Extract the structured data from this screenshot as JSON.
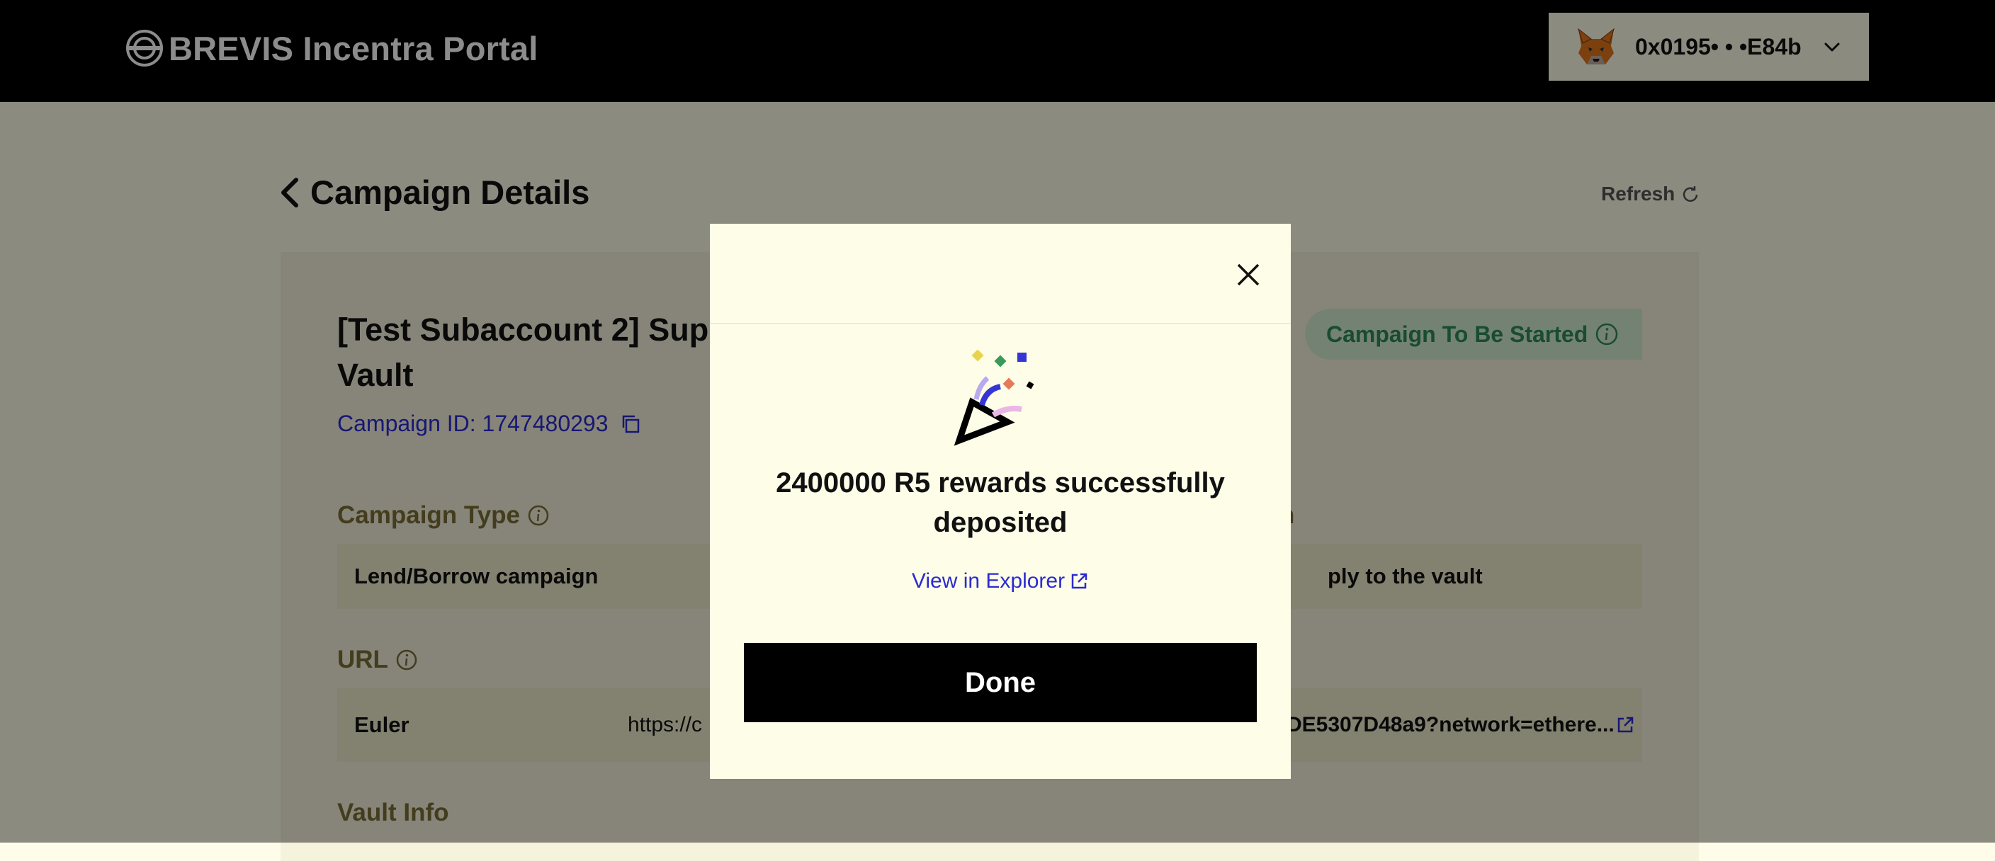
{
  "header": {
    "brand": "BREVIS Incentra Portal",
    "wallet_address": "0x0195• • •E84b"
  },
  "page": {
    "title": "Campaign Details",
    "refresh_label": "Refresh"
  },
  "campaign": {
    "title_visible_start": "[Test Subaccount 2] Sup",
    "title_visible_end": "Vault",
    "status": "Campaign To Be Started",
    "id_label": "Campaign ID: 1747480293",
    "campaign_type_label": "Campaign Type",
    "campaign_type_value": "Lend/Borrow campaign",
    "action_label_visible": "n",
    "action_value_visible": "ply to the vault",
    "url_label": "URL",
    "url_source": "Euler",
    "url_visible_start": "https://c",
    "url_visible_end": "DE5307D48a9?network=ethere...",
    "vault_info_label": "Vault Info"
  },
  "modal": {
    "message": "2400000 R5 rewards successfully deposited",
    "explorer_link": "View in Explorer",
    "done_button": "Done"
  },
  "colors": {
    "status_green": "#2e8a5b",
    "link_blue": "#2b2bd1",
    "accent_black": "#000000"
  },
  "icons": [
    "brevis-logo-icon",
    "metamask-fox-icon",
    "chevron-down-icon",
    "back-chevron-icon",
    "refresh-icon",
    "info-icon",
    "copy-icon",
    "close-icon",
    "party-popper-icon",
    "external-link-icon"
  ]
}
